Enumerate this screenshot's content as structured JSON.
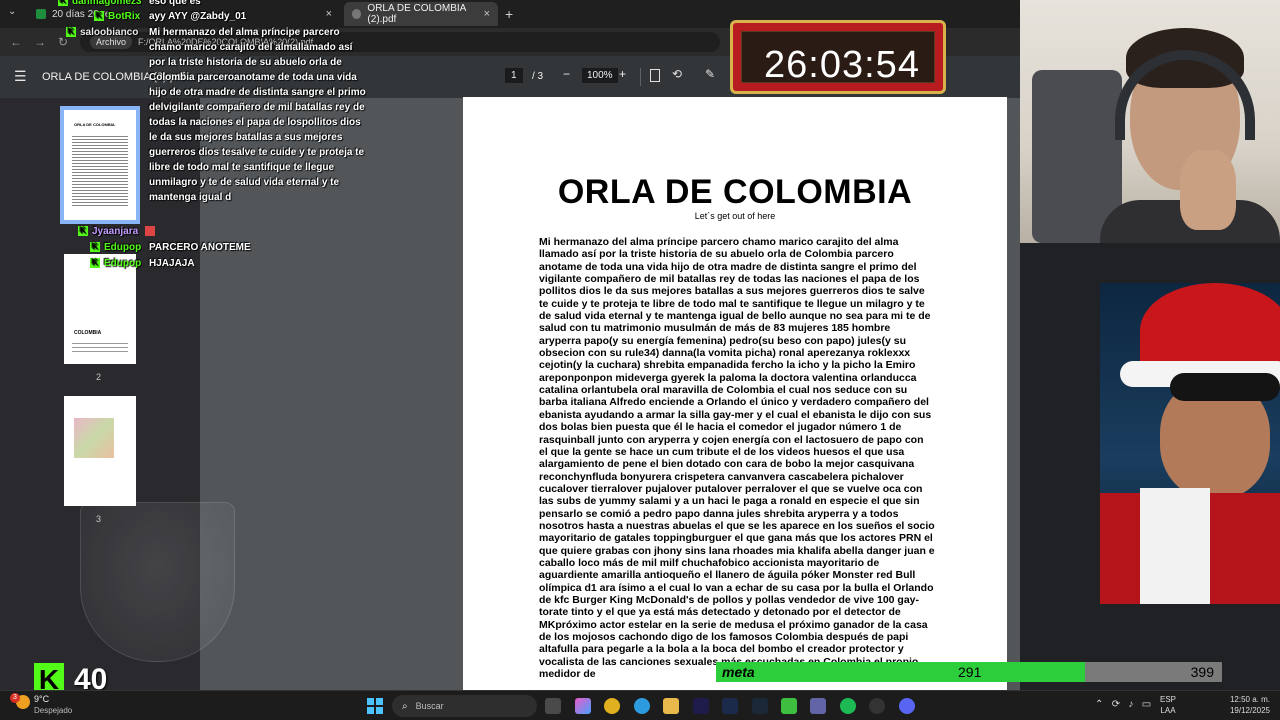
{
  "browser": {
    "tabs": [
      {
        "label": "20 días 20 re..."
      },
      {
        "label": "ORLA DE COLOMBIA (2).pdf"
      }
    ],
    "address_chip": "Archivo",
    "address_url": "F:/ORLA%20DE%20COLOMBIA%20(2).pdf",
    "new_tab_icon": "+",
    "close_icon": "×"
  },
  "pdf_toolbar": {
    "document_name": "ORLA DE COLOMBIA (2).pdf",
    "current_page": "1",
    "page_count": "/ 3",
    "zoom": "100%"
  },
  "sidebar": {
    "thumb1_title": "ORLA DE COLOMBIA",
    "thumb2_text": "COLOMBIA",
    "page_labels": [
      "2",
      "3"
    ]
  },
  "chat": {
    "messages": [
      {
        "user": "danmagomez3",
        "text": "eso que es"
      },
      {
        "user": "BotRix",
        "text": "ayy AYY @Zabdy_01"
      },
      {
        "user": "saloobianco",
        "text": "Mi hermanazo del alma príncipe parcero chamo marico carajito del almallamado así por la triste historia de su abuelo orla de Colombia parceroanotame de toda una vida hijo de otra madre de distinta sangre el primo delvigilante compañero de mil batallas rey de todas la naciones el papa de lospollitos dios le da sus mejores batallas a sus mejores guerreros dios tesalve te cuide y te proteja te libre de todo mal te santifique te llegue unmilagro y te de salud vida eternal y te mantenga igual d"
      },
      {
        "user": "Jyaanjara",
        "text": ""
      },
      {
        "user": "Edupop",
        "text": "PARCERO ANOTEME"
      },
      {
        "user": "Edupop",
        "text": "HJAJAJA"
      }
    ]
  },
  "document": {
    "title": "ORLA DE COLOMBIA",
    "subtitle": "Let´s get out of here",
    "body": "Mi hermanazo del alma príncipe parcero chamo marico carajito del alma llamado así por la triste historia de su abuelo orla de Colombia parcero anotame de toda una vida hijo de otra madre de distinta sangre el primo del vigilante compañero de mil batallas rey de todas las naciones el papa de los pollitos dios le da sus mejores batallas a sus mejores guerreros dios te salve te cuide y te proteja te libre de todo mal te santifique te llegue un milagro y te de salud vida eternal y te mantenga igual de bello aunque no sea para mi te de salud con tu matrimonio musulmán de más de 83 mujeres 185 hombre aryperra papo(y su energía femenina) pedro(su beso con papo) jules(y su obsecion con su rule34) danna(la vomita picha) ronal aperezanya roklexxx cejotin(y la cuchara) shrebita empanadida fercho la icho y la picho la Emiro areponponpon mideverga gyerek la paloma la doctora valentina orlanducca catalina orlantubela oral maravilla de Colombia el cual nos seduce con su barba italiana Alfredo enciende a Orlando el único y verdadero compañero del ebanista ayudando a armar la silla gay-mer y el cual el ebanista le dijo con sus dos bolas bien puesta que él le hacia el comedor el jugador número 1 de rasquinball junto con aryperra y cojen energía con el lactosuero de papo con el que la gente se hace un cum tribute el de los videos huesos el que usa alargamiento de pene el bien dotado con cara de bobo la mejor casquivana reconchynfluda bonyurera crispetera canvanvera cascabelera pichalover cucalover tierralover pujalover putalover perralover el que se vuelve oca con las subs de yummy salami y a un haci le paga a ronald en especie el que sin pensarlo se comió a pedro papo danna jules shrebita aryperra y a todos nosotros hasta a nuestras abuelas el que se les aparece en los sueños el socio mayoritario de gatales toppingburguer el que gana más que los actores PRN el que quiere grabas con jhony sins lana rhoades mia khalifa abella danger juan e caballo loco más de mil milf chuchafobico accionista mayoritario de aguardiente amarilla antioqueño el llanero de águila póker Monster red Bull olímpica d1 ara ísimo a el cual lo van a echar de su casa por la bulla el Orlando de kfc Burger King McDonald's de pollos y pollas vendedor de vive 100 gay-torate tinto y el que ya está más detectado y detonado por el detector de MKpróximo actor estelar en la serie de medusa el próximo ganador de la casa de los mojosos cachondo digo de los famosos Colombia después de papi altafulla para pegarle a la bola a la boca del bombo el creador protector y vocalista de las canciones sexuales más escuchadas en Colombia el propio medidor de"
  },
  "timer": {
    "value": "26:03:54"
  },
  "goal": {
    "label": "meta",
    "current": "291",
    "target": "399",
    "progress": 0.729
  },
  "kick": {
    "logo_letter": "K",
    "count": "40"
  },
  "taskbar": {
    "weather_badge": "3",
    "weather_temp": "9°C",
    "weather_desc": "Despejado",
    "search_placeholder": "Buscar",
    "lang_top": "ESP",
    "lang_bottom": "LAA",
    "time": "12:50 a. m.",
    "date": "19/12/2025"
  },
  "colors": {
    "accent_green": "#53fc18",
    "goal_green": "#2ccf3b",
    "timer_red": "#b81c20"
  }
}
